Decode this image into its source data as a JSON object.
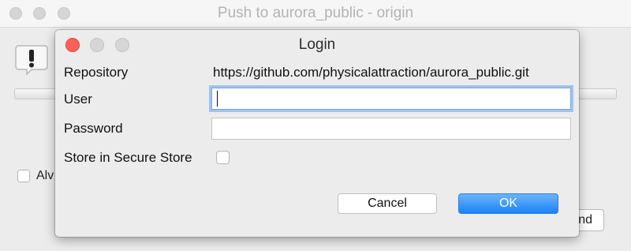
{
  "background_window": {
    "title": "Push to aurora_public - origin",
    "checkbox_label": "Alv",
    "send_button_label": "nd"
  },
  "dialog": {
    "title": "Login",
    "repository_label": "Repository",
    "repository_value": "https://github.com/physicalattraction/aurora_public.git",
    "user_label": "User",
    "user_value": "",
    "password_label": "Password",
    "password_value": "",
    "store_label": "Store in Secure Store",
    "store_checked": false,
    "cancel_label": "Cancel",
    "ok_label": "OK"
  },
  "colors": {
    "close_button": "#fc605b",
    "ok_button": "#1b82f8",
    "focus_ring": "#9ec4f2"
  }
}
